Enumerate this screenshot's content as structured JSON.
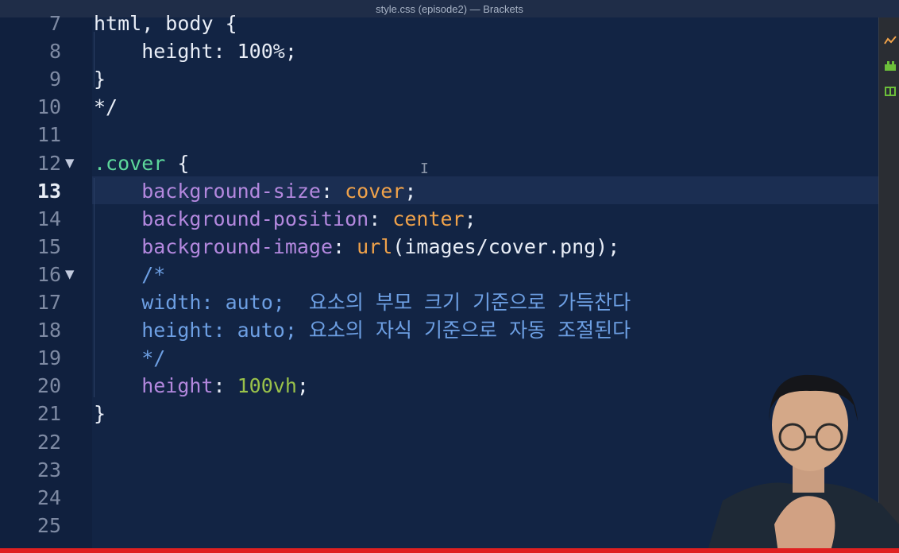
{
  "window": {
    "title": "style.css (episode2) — Brackets"
  },
  "editor": {
    "current_line": "13",
    "lines": [
      {
        "num": "7",
        "fold": "",
        "tokens": [
          {
            "t": "html, body {",
            "c": "tok-plain"
          }
        ]
      },
      {
        "num": "8",
        "fold": "",
        "tokens": [
          {
            "t": "    height: 100%;",
            "c": "tok-plain"
          }
        ]
      },
      {
        "num": "9",
        "fold": "",
        "tokens": [
          {
            "t": "}",
            "c": "tok-plain"
          }
        ]
      },
      {
        "num": "10",
        "fold": "",
        "tokens": [
          {
            "t": "*/",
            "c": "tok-plain"
          }
        ]
      },
      {
        "num": "11",
        "fold": "",
        "tokens": []
      },
      {
        "num": "12",
        "fold": "▼",
        "tokens": [
          {
            "t": ".cover",
            "c": "tok-sel"
          },
          {
            "t": " {",
            "c": "tok-punct"
          }
        ]
      },
      {
        "num": "13",
        "fold": "",
        "tokens": [
          {
            "t": "    background-size",
            "c": "tok-prop"
          },
          {
            "t": ": ",
            "c": "tok-punct"
          },
          {
            "t": "cover",
            "c": "tok-val"
          },
          {
            "t": ";",
            "c": "tok-punct"
          }
        ]
      },
      {
        "num": "14",
        "fold": "",
        "tokens": [
          {
            "t": "    background-position",
            "c": "tok-prop"
          },
          {
            "t": ": ",
            "c": "tok-punct"
          },
          {
            "t": "center",
            "c": "tok-val"
          },
          {
            "t": ";",
            "c": "tok-punct"
          }
        ]
      },
      {
        "num": "15",
        "fold": "",
        "tokens": [
          {
            "t": "    background-image",
            "c": "tok-prop"
          },
          {
            "t": ": ",
            "c": "tok-punct"
          },
          {
            "t": "url",
            "c": "tok-fn"
          },
          {
            "t": "(images/cover.png);",
            "c": "tok-punct"
          }
        ]
      },
      {
        "num": "16",
        "fold": "▼",
        "tokens": [
          {
            "t": "    /*",
            "c": "tok-cmt"
          }
        ]
      },
      {
        "num": "17",
        "fold": "",
        "tokens": [
          {
            "t": "    width: auto;  요소의 부모 크기 기준으로 가득찬다",
            "c": "tok-cmt"
          }
        ]
      },
      {
        "num": "18",
        "fold": "",
        "tokens": [
          {
            "t": "    height: auto; 요소의 자식 기준으로 자동 조절된다",
            "c": "tok-cmt"
          }
        ]
      },
      {
        "num": "19",
        "fold": "",
        "tokens": [
          {
            "t": "    */",
            "c": "tok-cmt"
          }
        ]
      },
      {
        "num": "20",
        "fold": "",
        "tokens": [
          {
            "t": "    height",
            "c": "tok-prop"
          },
          {
            "t": ": ",
            "c": "tok-punct"
          },
          {
            "t": "100vh",
            "c": "tok-num"
          },
          {
            "t": ";",
            "c": "tok-punct"
          }
        ]
      },
      {
        "num": "21",
        "fold": "",
        "tokens": [
          {
            "t": "}",
            "c": "tok-punct"
          }
        ]
      },
      {
        "num": "22",
        "fold": "",
        "tokens": []
      },
      {
        "num": "23",
        "fold": "",
        "tokens": []
      },
      {
        "num": "24",
        "fold": "",
        "tokens": []
      },
      {
        "num": "25",
        "fold": "",
        "tokens": []
      }
    ]
  },
  "right_panel": {
    "icons": [
      "live-preview-icon",
      "extension-manager-icon",
      "extract-icon"
    ],
    "colors": {
      "live_preview": "#f0a24a",
      "extensions": "#6cbf3a",
      "extract": "#6cbf3a"
    }
  },
  "colors": {
    "background": "#10203e",
    "active_line": "#1b2e52",
    "progress_bar": "#e02020"
  }
}
